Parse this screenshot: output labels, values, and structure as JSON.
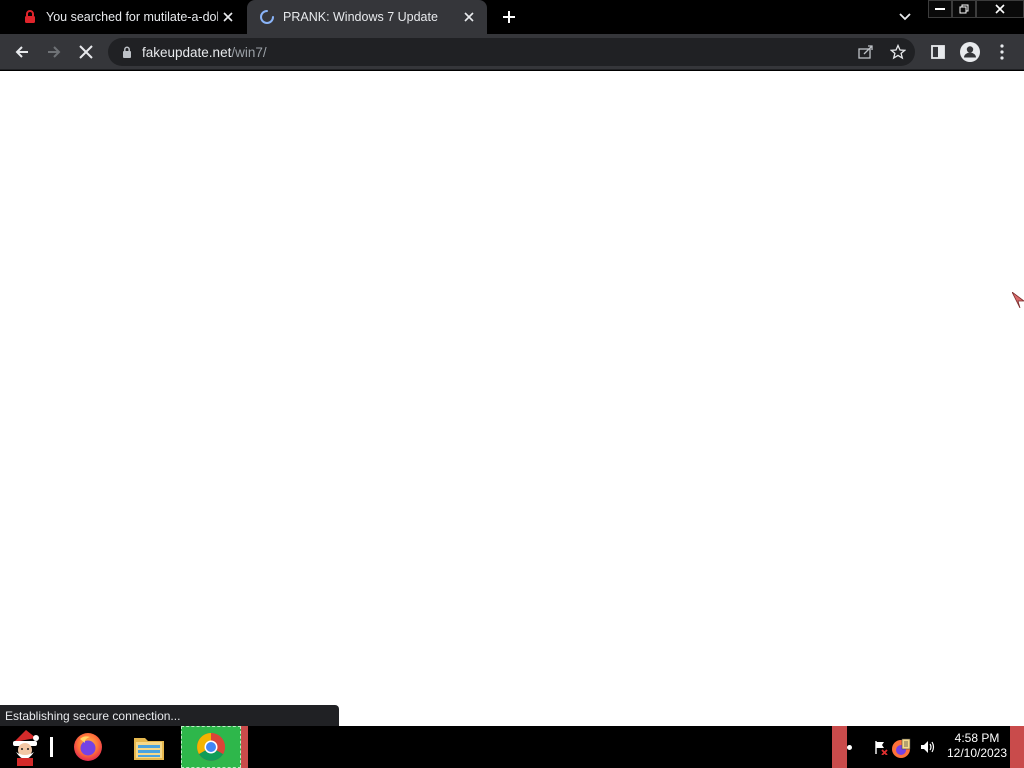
{
  "browser": {
    "tabs": [
      {
        "title": "You searched for mutilate-a-doll",
        "favicon": "red-lock-icon",
        "active": false
      },
      {
        "title": "PRANK: Windows 7 Update",
        "favicon": "loading-spinner-icon",
        "active": true
      }
    ],
    "address": {
      "domain": "fakeupdate.net",
      "path": "/win7/"
    },
    "status_text": "Establishing secure connection..."
  },
  "taskbar": {
    "time": "4:58 PM",
    "date": "12/10/2023",
    "apps": [
      "santa-start-icon",
      "firefox-icon",
      "file-explorer-icon",
      "chrome-icon"
    ]
  },
  "colors": {
    "tab_active_bg": "#35363a",
    "omnibox_bg": "#202124",
    "chrome_taskbar_highlight": "#2eb74b",
    "tray_red": "#c94b4b"
  }
}
